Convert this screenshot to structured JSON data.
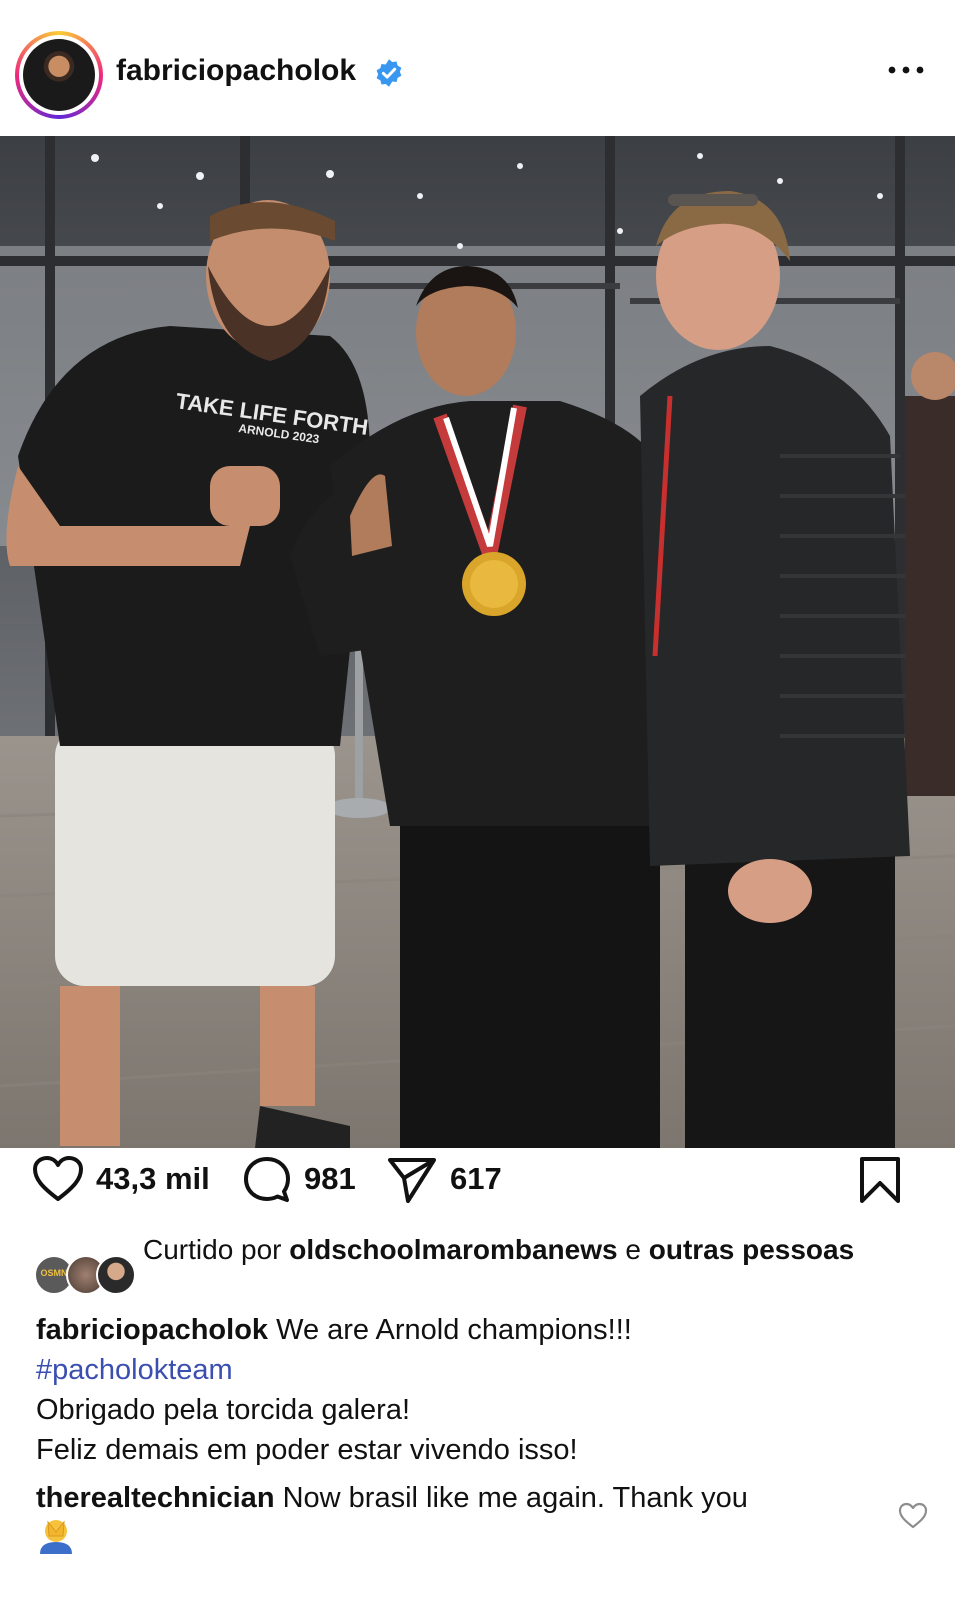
{
  "post": {
    "username": "fabriciopacholok",
    "verified": true,
    "more_icon": "more-horizontal-icon"
  },
  "actions": {
    "likes": "43,3 mil",
    "comments": "981",
    "shares": "617"
  },
  "liked_by": {
    "prefix": "Curtido por",
    "user": "oldschoolmarombanews",
    "connector": "e",
    "others": "outras pessoas",
    "avatar_label": "OSMN"
  },
  "caption": {
    "username": "fabriciopacholok",
    "text": "We are Arnold champions!!!",
    "hashtag": "#pacholokteam",
    "line2": "Obrigado pela torcida galera!",
    "line3": "Feliz demais em poder estar vivendo isso!"
  },
  "comment": {
    "username": "therealtechnician",
    "text": "Now brasil like me again. Thank you"
  },
  "photo": {
    "shirt_text": "TAKE LIFE FORTH",
    "shirt_sub": "ARNOLD 2023"
  },
  "colors": {
    "verified_blue": "#3897f0",
    "hashtag": "#3b4fb0",
    "text": "#111111"
  }
}
